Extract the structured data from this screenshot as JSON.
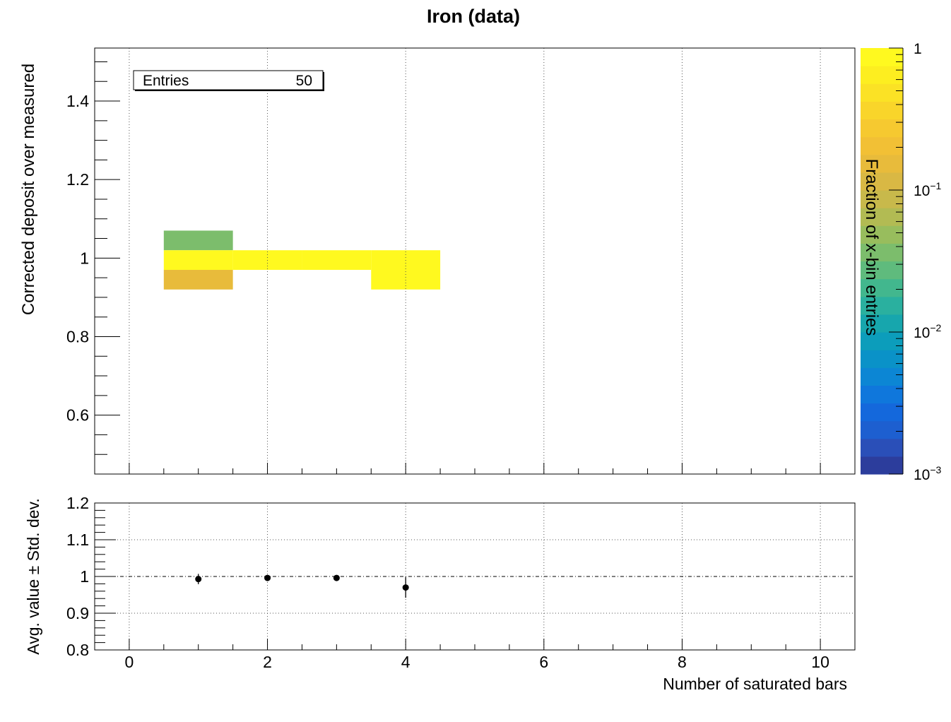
{
  "chart_data": [
    {
      "type": "heatmap",
      "title": "Iron (data)",
      "xlabel": "",
      "ylabel": "Corrected deposit over measured",
      "xlim": [
        -0.5,
        10.5
      ],
      "ylim": [
        0.45,
        1.535
      ],
      "x_ticks": [
        0,
        2,
        4,
        6,
        8,
        10
      ],
      "y_ticks": [
        0.6,
        0.8,
        1,
        1.2,
        1.4
      ],
      "grid": true,
      "stats_box": {
        "label": "Entries",
        "value": "50"
      },
      "colorbar": {
        "label": "Fraction of x-bin entries",
        "scale": "log",
        "range": [
          0.001,
          1
        ],
        "tick_labels": [
          {
            "value": 1,
            "base": "1",
            "exp": ""
          },
          {
            "value": 0.1,
            "base": "10",
            "exp": "−1"
          },
          {
            "value": 0.01,
            "base": "10",
            "exp": "−2"
          },
          {
            "value": 0.001,
            "base": "10",
            "exp": "−3"
          }
        ],
        "palette": [
          "#2c3d9c",
          "#2a4fb8",
          "#1d5fd0",
          "#1468dc",
          "#0f77dc",
          "#0c86d4",
          "#0a92c8",
          "#0c9dbb",
          "#17a6ad",
          "#2ab09f",
          "#42b78e",
          "#5fbb7d",
          "#7cbd6c",
          "#98bd5d",
          "#b2bb53",
          "#c8b94b",
          "#d9b844",
          "#e8bb3b",
          "#f2c035",
          "#f6c930",
          "#f9d52a",
          "#fbe225",
          "#fdee20",
          "#fff91f"
        ]
      },
      "cells": [
        {
          "x": [
            0.5,
            1.5
          ],
          "y": [
            1.02,
            1.07
          ],
          "value": 0.04
        },
        {
          "x": [
            0.5,
            1.5
          ],
          "y": [
            0.97,
            1.02
          ],
          "value": 0.94
        },
        {
          "x": [
            0.5,
            1.5
          ],
          "y": [
            0.92,
            0.97
          ],
          "value": 0.14
        },
        {
          "x": [
            1.5,
            2.5
          ],
          "y": [
            0.97,
            1.02
          ],
          "value": 1.0
        },
        {
          "x": [
            2.5,
            3.5
          ],
          "y": [
            0.97,
            1.02
          ],
          "value": 1.0
        },
        {
          "x": [
            3.5,
            4.5
          ],
          "y": [
            0.92,
            1.02
          ],
          "value": 0.75
        }
      ]
    },
    {
      "type": "scatter",
      "title": "",
      "xlabel": "Number of saturated bars",
      "ylabel": "Avg. value ± Std. dev.",
      "xlim": [
        -0.5,
        10.5
      ],
      "ylim": [
        0.8,
        1.2
      ],
      "x_ticks": [
        0,
        2,
        4,
        6,
        8,
        10
      ],
      "y_ticks": [
        0.8,
        0.9,
        1,
        1.1,
        1.2
      ],
      "grid": true,
      "reference_line": 1,
      "points": [
        {
          "x": 1,
          "y": 0.993,
          "err": 0.014
        },
        {
          "x": 2,
          "y": 0.996,
          "err": 0.004
        },
        {
          "x": 3,
          "y": 0.996,
          "err": 0.004
        },
        {
          "x": 4,
          "y": 0.97,
          "err": 0.028
        }
      ]
    }
  ]
}
